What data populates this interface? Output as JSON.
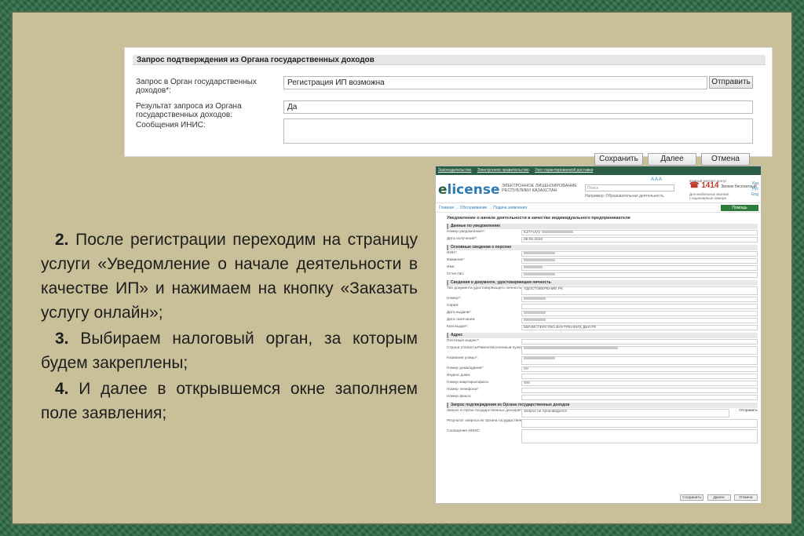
{
  "panel1": {
    "header": "Запрос подтверждения из Органа государственных доходов",
    "request_label": "Запрос в Орган государственных доходов*:",
    "request_value": "Регистрация ИП возможна",
    "send_button": "Отправить",
    "result_label": "Результат запроса из Органа государственных доходов:",
    "result_value": "Да",
    "inis_label": "Сообщения ИНИС:",
    "inis_value": "",
    "save_button": "Сохранить",
    "next_button": "Далее",
    "cancel_button": "Отмена"
  },
  "text": {
    "p1_num": "2.",
    "p1": "После регистрации переходим на страницу услуги «Уведомление о начале деятельности в качестве ИП» и нажимаем на кнопку «Заказать услугу онлайн»;",
    "p2_num": "3.",
    "p2": "Выбираем налоговый орган, за которым будем закреплены;",
    "p3_num": "4.",
    "p3": "И далее в открывшемся окне заполняем поле заявления;"
  },
  "panel2": {
    "top_links": [
      "Законодательство",
      "Электронное правительство",
      "Узел гарантированной доставки"
    ],
    "logo_e": "e",
    "logo_rest": "license",
    "logo_sub": "ЭЛЕКТРОННОЕ ЛИЦЕНЗИРОВАНИЕ РЕСПУБЛИКИ КАЗАХСТАН",
    "search_placeholder": "Поиск",
    "search_note": "Например: Образовательная деятельность",
    "lang": "A  A  A",
    "phone_top": "Единый контакт-центр",
    "phone": "1414",
    "phone_note": "Звонок бесплатный",
    "phone_sub": "Для мобильных звонков стационарные номера",
    "right_links": [
      "Каз",
      "Рус",
      "Eng"
    ],
    "breadcrumb": "Главная → Обслуживание → Подача заявления",
    "help_button": "Помощь",
    "title": "Уведомление о начале деятельности в качестве индивидуального предпринимателя",
    "sections": {
      "s1": "Данные по уведомлению",
      "s2": "Основные сведения о персоне",
      "s3": "Сведения о документе, удостоверяющем личность",
      "s4": "Адрес",
      "s5": "Запрос подтверждения из Органа государственных доходов"
    },
    "fields": {
      "notice_no": "Номер уведомления*:",
      "notice_no_val": "KZ77UVV",
      "date": "Дата получения*:",
      "date_val": "09.06.2016",
      "iin": "ИИН*:",
      "surname": "Фамилия*:",
      "name": "Имя:",
      "patronymic": "Отчество:",
      "doc_type": "Тип документа удостоверяющего личность*:",
      "doc_type_val": "УДОСТОВЕРЕНИЕ РК",
      "doc_no": "Номер*:",
      "series": "Серия:",
      "issue_date": "Дата выдачи*:",
      "expiry": "Дата окончания:",
      "issuer": "Кем выдан*:",
      "issuer_val": "МИНИСТЕРСТВО ВНУТРЕННИХ ДЕЛ РК",
      "postal": "Почтовый индекс*:",
      "region": "Страна (Область/Район/Населенный пункт)*:",
      "street": "Название улицы*:",
      "house": "Номер дома/здания*:",
      "index": "Индекс дома:",
      "flat": "Номер квартиры/офиса:",
      "phone": "Номер телефона*:",
      "fax": "Номер факса:",
      "req": "Запрос в Орган государственных доходов*:",
      "req_val": "Запрос не производился",
      "req_send": "Отправить",
      "res": "Результат запроса из Органа государственных доходов:",
      "inis": "Сообщения ИНИС:"
    },
    "footer": [
      "Сохранить",
      "Далее",
      "Отмена"
    ]
  }
}
